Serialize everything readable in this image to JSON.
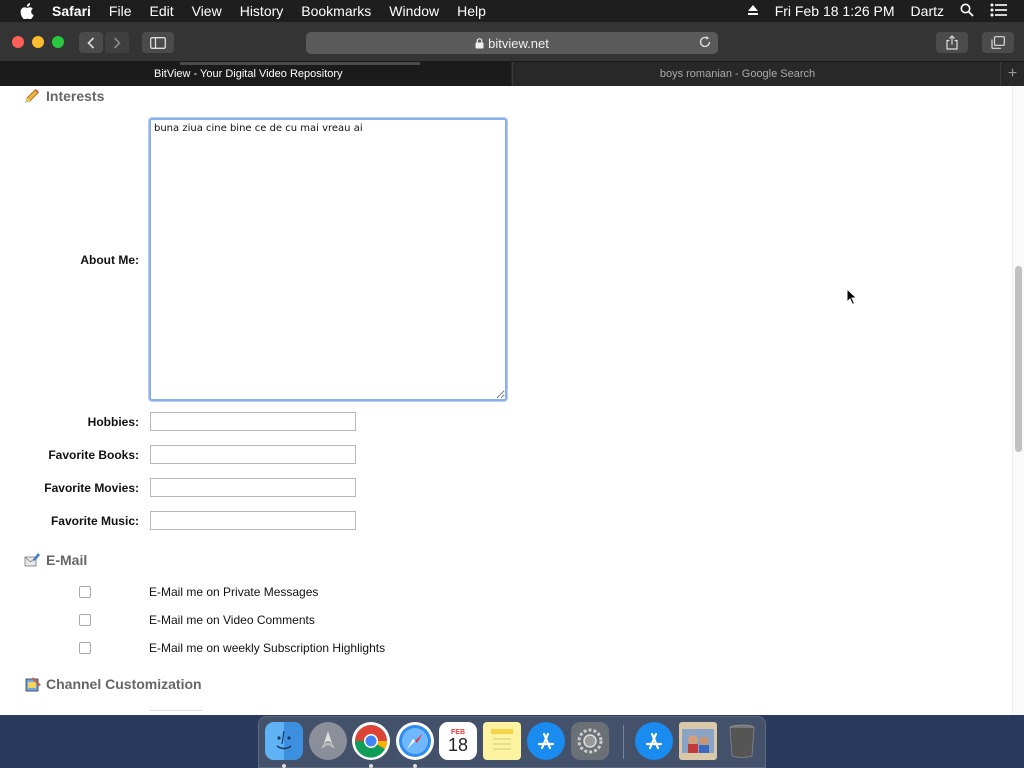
{
  "menubar": {
    "app_name": "Safari",
    "items": [
      "File",
      "Edit",
      "View",
      "History",
      "Bookmarks",
      "Window",
      "Help"
    ],
    "datetime": "Fri Feb 18  1:26 PM",
    "user": "Dartz"
  },
  "toolbar": {
    "url": "bitview.net"
  },
  "tabs": {
    "active": "BitView - Your Digital Video Repository",
    "inactive": "boys romanian - Google Search",
    "add": "+"
  },
  "page": {
    "interests_heading": "Interests",
    "about_label": "About Me:",
    "about_value": "buna ziua cine bine ce de cu mai vreau ai",
    "fields": {
      "hobbies_label": "Hobbies:",
      "books_label": "Favorite Books:",
      "movies_label": "Favorite Movies:",
      "music_label": "Favorite Music:"
    },
    "email_heading": "E-Mail",
    "email_options": {
      "private_messages": "E-Mail me on Private Messages",
      "video_comments": "E-Mail me on Video Comments",
      "subscription_highlights": "E-Mail me on weekly Subscription Highlights"
    },
    "channel_heading": "Channel Customization"
  },
  "dock": {
    "apps": [
      "finder-icon",
      "launchpad-icon",
      "chrome-icon",
      "safari-icon",
      "calendar-icon",
      "notes-icon",
      "app-store-icon",
      "system-preferences-icon",
      "app-store-downloads-icon",
      "photo-icon",
      "trash-icon"
    ],
    "calendar_month": "FEB",
    "calendar_day": "18"
  }
}
